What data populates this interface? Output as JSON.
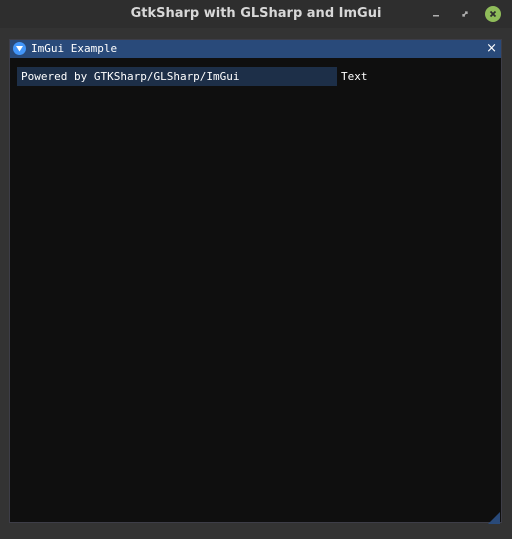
{
  "app": {
    "window_title": "GtkSharp with GLSharp and ImGui"
  },
  "window_controls": {
    "minimize_icon": "minimize-icon",
    "maximize_icon": "maximize-icon",
    "close_icon": "close-icon",
    "close_color": "#8fbc5a"
  },
  "imgui_window": {
    "title": "ImGui Example",
    "close_glyph": "×",
    "titlebar_color": "#294a7a",
    "background_color": "#0f0f0f"
  },
  "text_input": {
    "value": "Powered by GTKSharp/GLSharp/ImGui",
    "label": "Text",
    "frame_color": "#1d2f48"
  },
  "colors": {
    "accent": "#4296fa"
  }
}
